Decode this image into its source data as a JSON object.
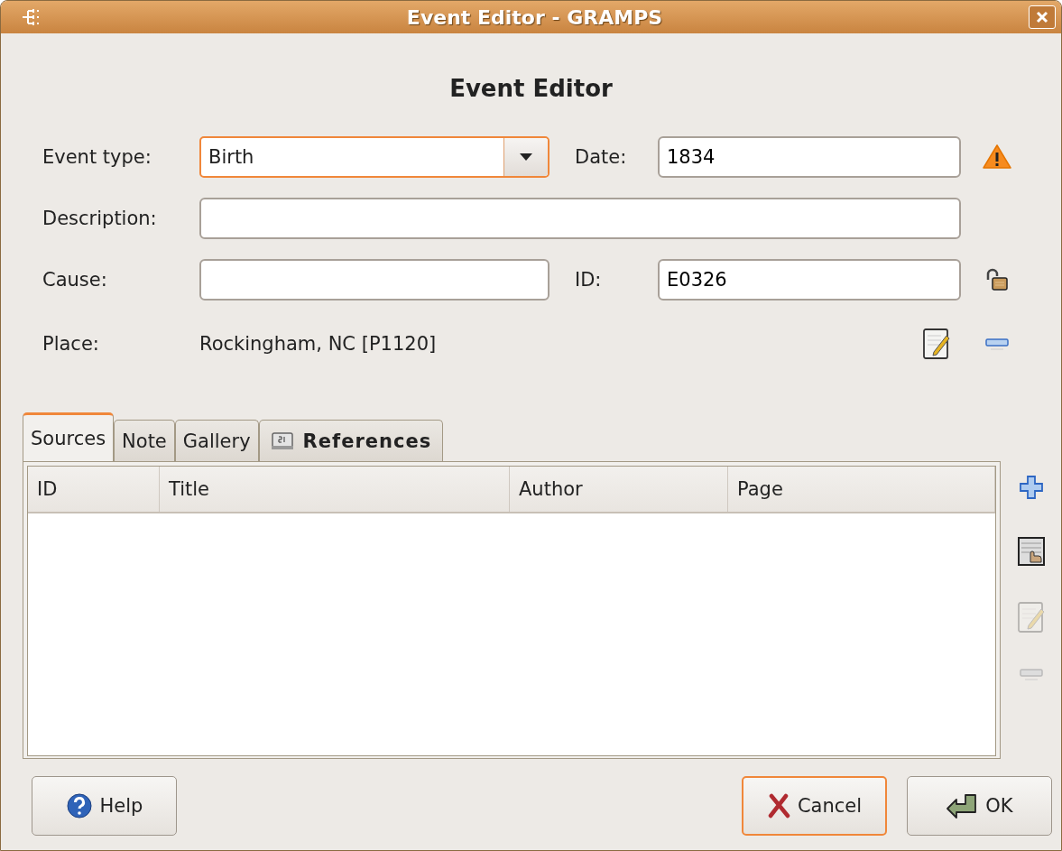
{
  "window": {
    "title": "Event Editor - GRAMPS"
  },
  "heading": "Event Editor",
  "form": {
    "event_type": {
      "label": "Event type:",
      "value": "Birth",
      "focused": true
    },
    "date": {
      "label": "Date:",
      "value": "1834"
    },
    "description": {
      "label": "Description:"
    },
    "cause": {
      "label": "Cause:"
    },
    "id": {
      "label": "ID:",
      "value": "E0326"
    },
    "place": {
      "label": "Place:",
      "value": "Rockingham, NC [P1120]"
    }
  },
  "tabs": [
    {
      "label": "Sources",
      "selected": true,
      "bold": false,
      "icon": false
    },
    {
      "label": "Note",
      "selected": false,
      "bold": false,
      "icon": false
    },
    {
      "label": "Gallery",
      "selected": false,
      "bold": false,
      "icon": false
    },
    {
      "label": "References",
      "selected": false,
      "bold": true,
      "icon": true
    }
  ],
  "table": {
    "columns": [
      "ID",
      "Title",
      "Author",
      "Page"
    ]
  },
  "side_buttons": [
    {
      "kind": "add",
      "disabled": false
    },
    {
      "kind": "share",
      "disabled": false
    },
    {
      "kind": "edit",
      "disabled": true
    },
    {
      "kind": "remove",
      "disabled": true
    }
  ],
  "buttons": [
    {
      "kind": "help",
      "label": "Help",
      "focused": false
    },
    {
      "kind": "cancel",
      "label": "Cancel",
      "focused": true
    },
    {
      "kind": "ok",
      "label": "OK",
      "focused": false
    }
  ]
}
